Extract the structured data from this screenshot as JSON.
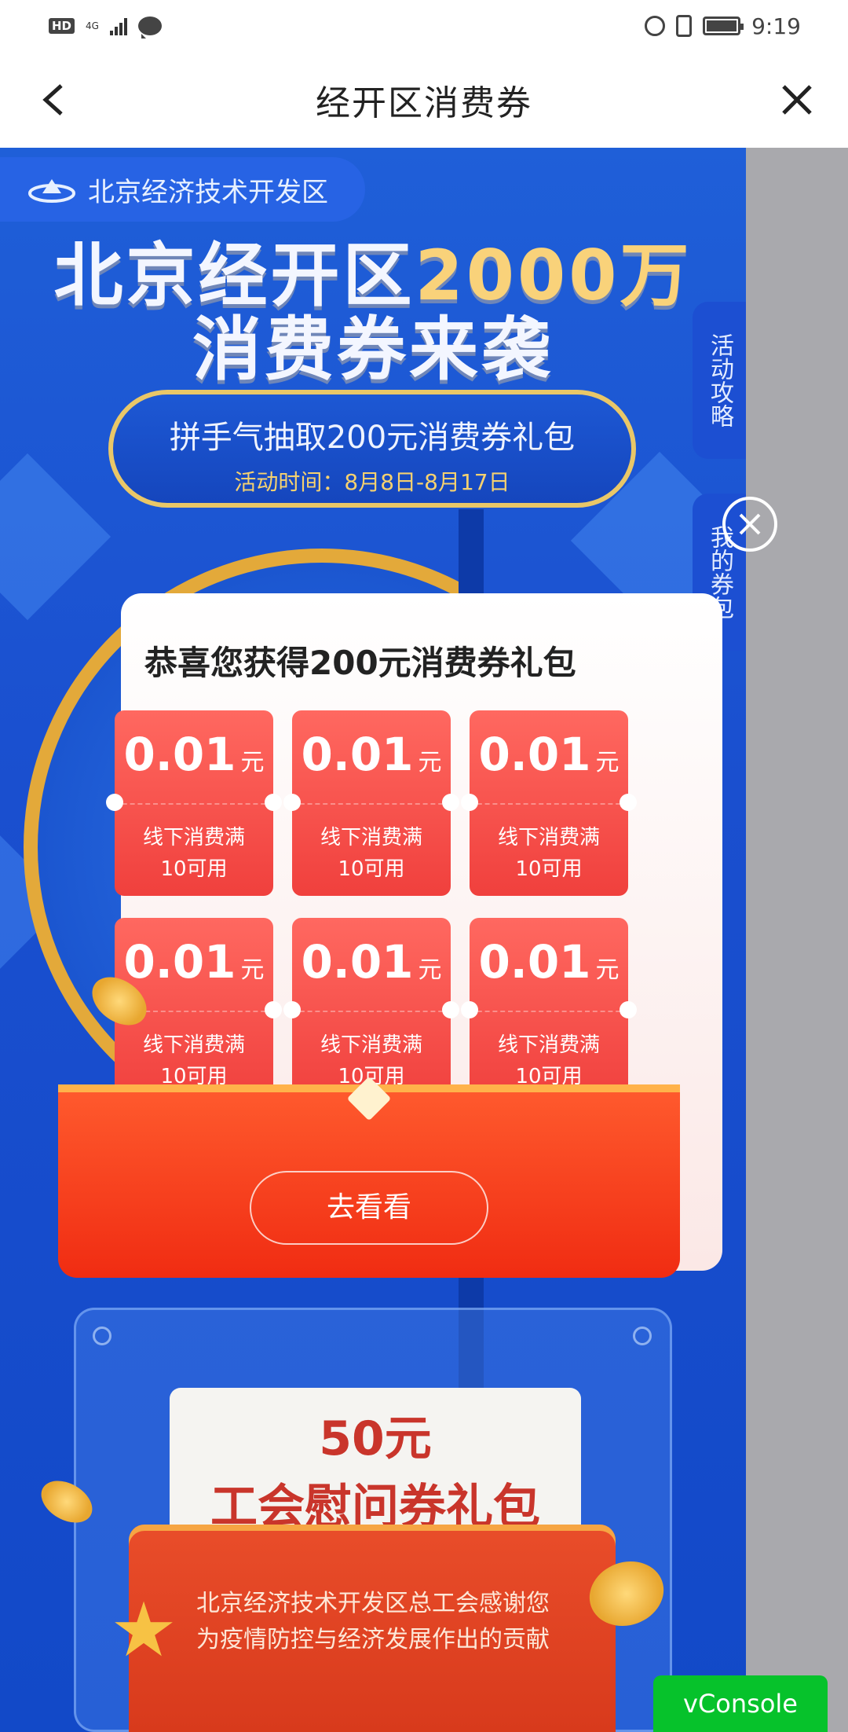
{
  "status_bar": {
    "hd": "HD",
    "network": "4G",
    "time": "9:19"
  },
  "nav": {
    "title": "经开区消费券"
  },
  "header": {
    "org_name": "北京经济技术开发区",
    "title_line1_a": "北京经开区",
    "title_line1_b": "2000万",
    "title_line2": "消费券来袭",
    "pill_main": "拼手气抽取200元消费券礼包",
    "pill_sub": "活动时间：8月8日-8月17日"
  },
  "side_tabs": {
    "guide": "活动攻略",
    "my_coupons": "我的券包"
  },
  "modal": {
    "heading": "恭喜您获得200元消费券礼包",
    "coupons": [
      {
        "amount": "0.01",
        "unit": "元",
        "cond1": "线下消费满",
        "cond2": "10可用"
      },
      {
        "amount": "0.01",
        "unit": "元",
        "cond1": "线下消费满",
        "cond2": "10可用"
      },
      {
        "amount": "0.01",
        "unit": "元",
        "cond1": "线下消费满",
        "cond2": "10可用"
      },
      {
        "amount": "0.01",
        "unit": "元",
        "cond1": "线下消费满",
        "cond2": "10可用"
      },
      {
        "amount": "0.01",
        "unit": "元",
        "cond1": "线下消费满",
        "cond2": "10可用"
      },
      {
        "amount": "0.01",
        "unit": "元",
        "cond1": "线下消费满",
        "cond2": "10可用"
      }
    ],
    "action_label": "去看看"
  },
  "lower_card": {
    "ticket_line1": "50元",
    "ticket_line2": "工会慰问券礼包",
    "desc_line1": "北京经济技术开发区总工会感谢您",
    "desc_line2": "为疫情防控与经济发展作出的贡献"
  },
  "vconsole_label": "vConsole",
  "colors": {
    "brand_blue": "#1a4fcf",
    "gold": "#f9d27a",
    "coupon_red": "#f0403d",
    "vconsole_green": "#06c22b"
  }
}
